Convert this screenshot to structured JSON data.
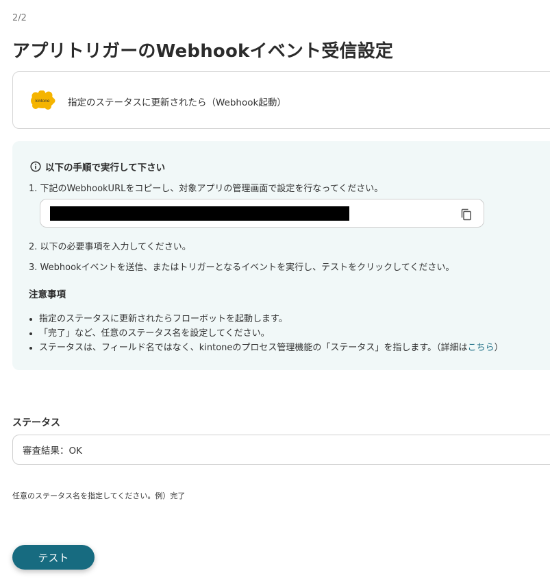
{
  "header": {
    "step_indicator": "2/2",
    "title": "アプリトリガーのWebhookイベント受信設定"
  },
  "trigger": {
    "logo_icon": "kintone-logo-icon",
    "logo_text": "kintone",
    "description": "指定のステータスに更新されたら（Webhook起動）"
  },
  "instructions": {
    "title": "以下の手順で実行して下さい",
    "step1": "1. 下記のWebhookURLをコピーし、対象アプリの管理画面で設定を行なってください。",
    "url_copy_icon": "copy-icon",
    "step2": "2. 以下の必要事項を入力してください。",
    "step3": "3. Webhookイベントを送信、またはトリガーとなるイベントを実行し、テストをクリックしてください。",
    "notes_heading": "注意事項",
    "notes": [
      "指定のステータスに更新されたらフローボットを起動します。",
      "「完了」など、任意のステータス名を設定してください。"
    ],
    "note3_prefix": "ステータスは、フィールド名ではなく、kintoneのプロセス管理機能の「ステータス」を指します。（詳細は",
    "note3_link": "こちら",
    "note3_suffix": "）"
  },
  "form": {
    "status_label": "ステータス",
    "status_value": "審査結果：OK",
    "status_hint": "任意のステータス名を指定してください。例）完了"
  },
  "actions": {
    "test_label": "テスト"
  },
  "colors": {
    "primary": "#176b80",
    "info_bg": "#f1f8f8",
    "link": "#1f6f86",
    "kintone_yellow": "#f5b400"
  }
}
